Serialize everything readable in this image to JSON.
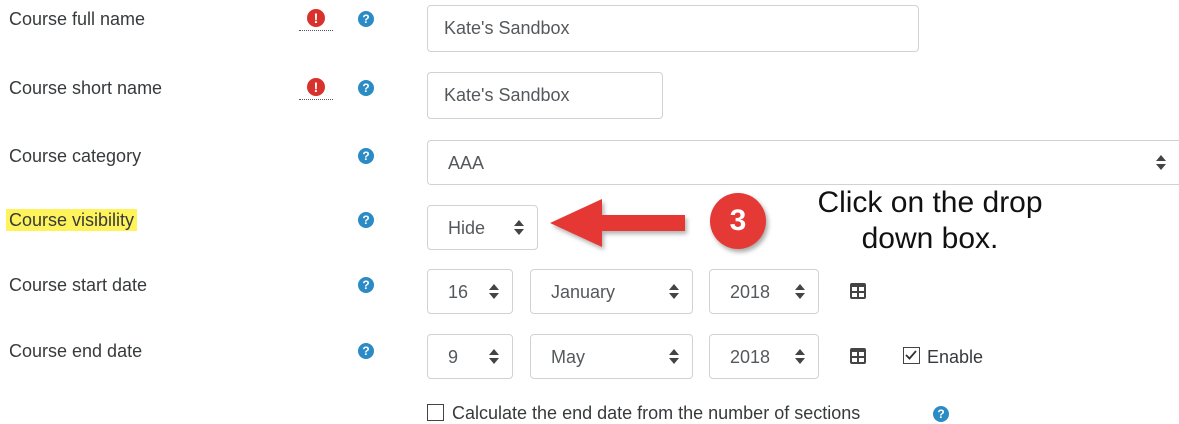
{
  "fields": {
    "full_name": {
      "label": "Course full name",
      "value": "Kate's Sandbox"
    },
    "short_name": {
      "label": "Course short name",
      "value": "Kate's Sandbox"
    },
    "category": {
      "label": "Course category",
      "value": "AAA"
    },
    "visibility": {
      "label": "Course visibility",
      "value": "Hide"
    },
    "start_date": {
      "label": "Course start date",
      "day": "16",
      "month": "January",
      "year": "2018"
    },
    "end_date": {
      "label": "Course end date",
      "day": "9",
      "month": "May",
      "year": "2018",
      "enable_label": "Enable",
      "enabled": true
    },
    "calc_end": {
      "label": "Calculate the end date from the number of sections",
      "checked": false
    }
  },
  "icons": {
    "required": "!",
    "help": "?",
    "checkmark": "✓"
  },
  "annotation": {
    "step_number": "3",
    "line1": "Click on the drop",
    "line2": "down box."
  },
  "colors": {
    "required_icon": "#d9312b",
    "help_icon": "#2b8bc5",
    "highlight": "#fff35c",
    "arrow": "#e53935",
    "badge": "#e53935"
  }
}
